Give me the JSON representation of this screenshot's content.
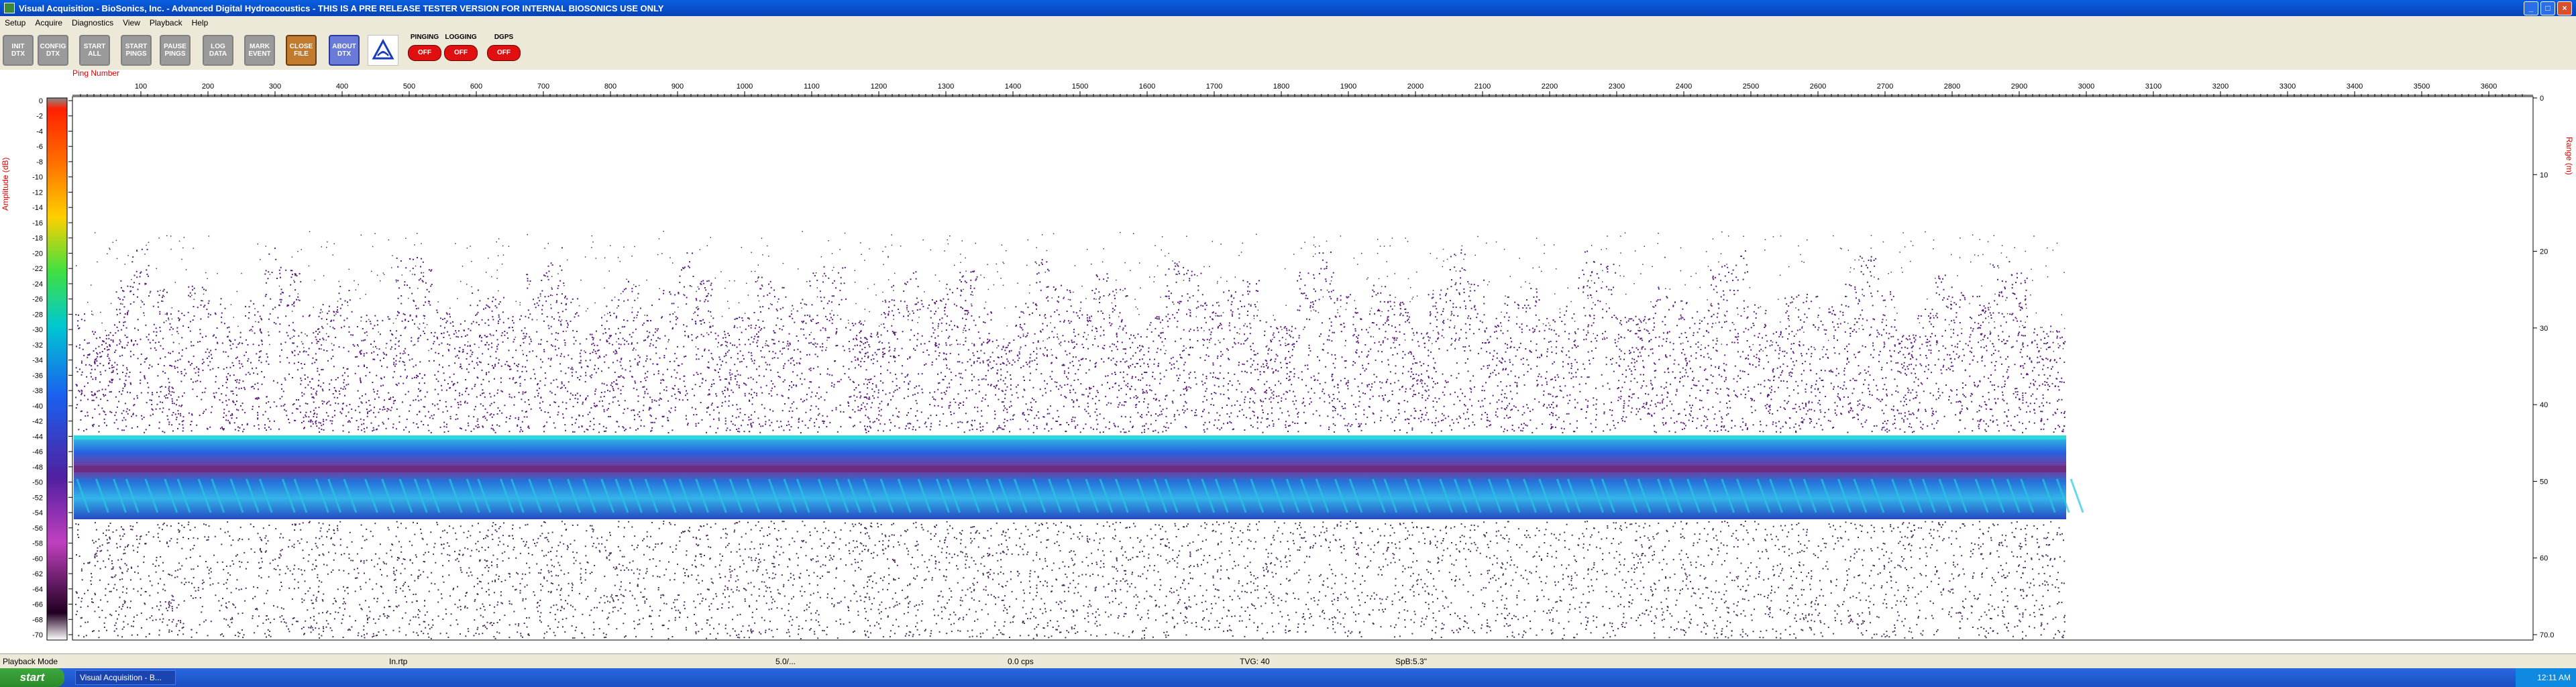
{
  "window": {
    "title": "Visual Acquisition  -  BioSonics, Inc.  -  Advanced Digital Hydroacoustics  -  THIS IS A PRE RELEASE TESTER VERSION FOR INTERNAL BIOSONICS USE ONLY"
  },
  "menu": [
    "Setup",
    "Acquire",
    "Diagnostics",
    "View",
    "Playback",
    "Help"
  ],
  "toolbar": {
    "buttons": [
      "INIT\nDTX",
      "CONFIG\nDTX",
      "START\nALL",
      "START\nPINGS",
      "PAUSE\nPINGS",
      "LOG\nDATA",
      "MARK\nEVENT",
      "CLOSE\nFILE",
      "ABOUT\nDTX"
    ],
    "indicators": [
      {
        "label": "PINGING",
        "lamp": "OFF"
      },
      {
        "label": "LOGGING",
        "lamp": "OFF"
      },
      {
        "label": "DGPS",
        "lamp": "OFF"
      }
    ]
  },
  "echogram": {
    "ping_label": "Ping Number",
    "amp_label": "Amplitude (dB)",
    "range_label": "Range (m)",
    "ping_ticks": [
      "100",
      "200",
      "300",
      "400",
      "500",
      "600",
      "700",
      "800",
      "900",
      "1000",
      "1100",
      "1200",
      "1300",
      "1400",
      "1500",
      "1600",
      "1700",
      "1800",
      "1900",
      "2000",
      "2100",
      "2200",
      "2300",
      "2400",
      "2500",
      "2600",
      "2700",
      "2800",
      "2900",
      "3000",
      "3100",
      "3200",
      "3300",
      "3400",
      "3500",
      "3600"
    ],
    "amp_ticks": [
      "0",
      "-2",
      "-4",
      "-6",
      "-8",
      "-10",
      "-12",
      "-14",
      "-16",
      "-18",
      "-20",
      "-22",
      "-24",
      "-26",
      "-28",
      "-30",
      "-32",
      "-34",
      "-36",
      "-38",
      "-40",
      "-42",
      "-44",
      "-46",
      "-48",
      "-50",
      "-52",
      "-54",
      "-56",
      "-58",
      "-60",
      "-62",
      "-64",
      "-66",
      "-68",
      "-70"
    ],
    "range_ticks": [
      "0",
      "10",
      "20",
      "30",
      "40",
      "50",
      "60",
      "70.0"
    ],
    "colors": {
      "noise": "#5a1a7a",
      "band": "#1a6ad8",
      "band_hi": "#28c8e0"
    }
  },
  "status": {
    "mode": "Playback Mode",
    "file": "In.rtp",
    "ping_rate": "5.0/...",
    "speed": "0.0 cps",
    "tvg": "TVG: 40",
    "spb": "SpB:5.3\""
  },
  "taskbar": {
    "start": "start",
    "item": "Visual Acquisition - B...",
    "clock": "12:11 AM"
  }
}
